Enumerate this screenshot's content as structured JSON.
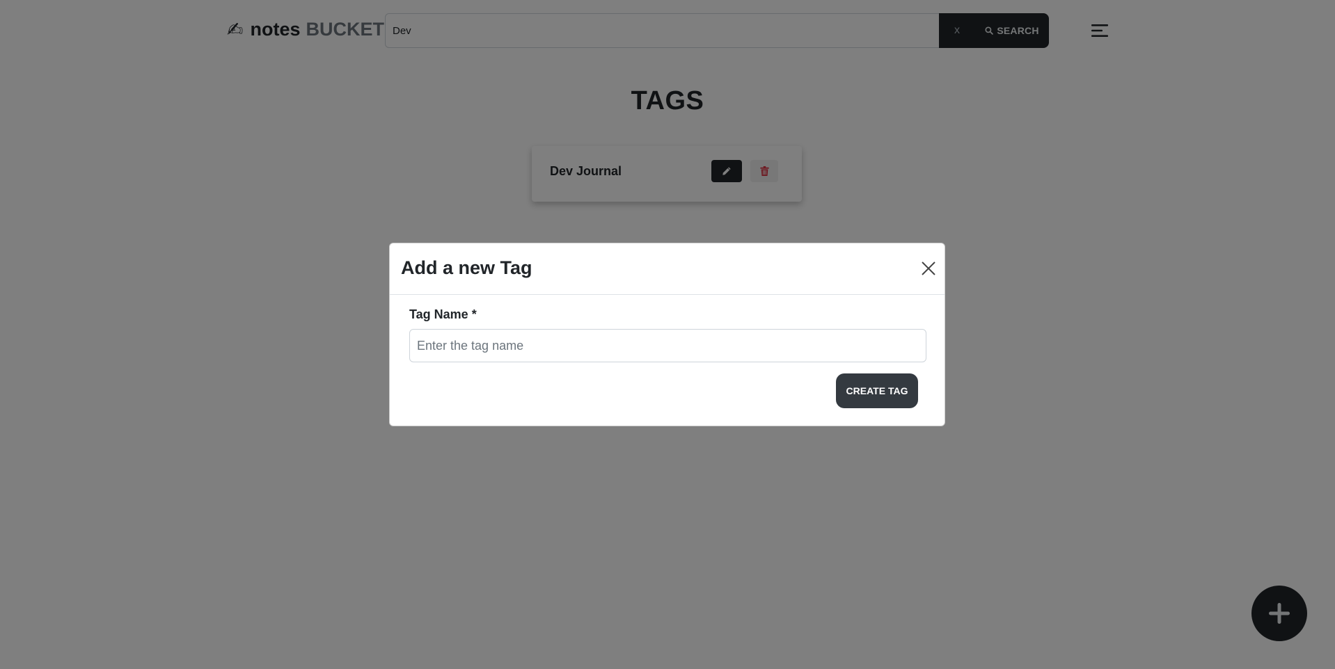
{
  "navbar": {
    "brand_icon": "✍",
    "brand_main": "notes",
    "brand_accent": "BUCKET",
    "search_value": "Dev",
    "clear_label": "x",
    "search_label": "SEARCH",
    "search_icon": "magnifier-icon",
    "menu_icon": "hamburger-menu-icon"
  },
  "page": {
    "title": "TAGS"
  },
  "tags": [
    {
      "name": "Dev Journal",
      "edit_icon": "pencil-icon",
      "delete_icon": "trash-icon"
    }
  ],
  "fab": {
    "icon": "plus-icon"
  },
  "modal": {
    "title": "Add a new Tag",
    "close_icon": "close-icon",
    "field_label": "Tag Name *",
    "input_value": "",
    "input_placeholder": "Enter the tag name",
    "submit_label": "CREATE TAG"
  },
  "colors": {
    "dark": "#212529",
    "button_dark": "#343a40",
    "delete_red": "#dc3545",
    "muted": "#6c757d",
    "backdrop": "rgba(0,0,0,0.5)"
  }
}
